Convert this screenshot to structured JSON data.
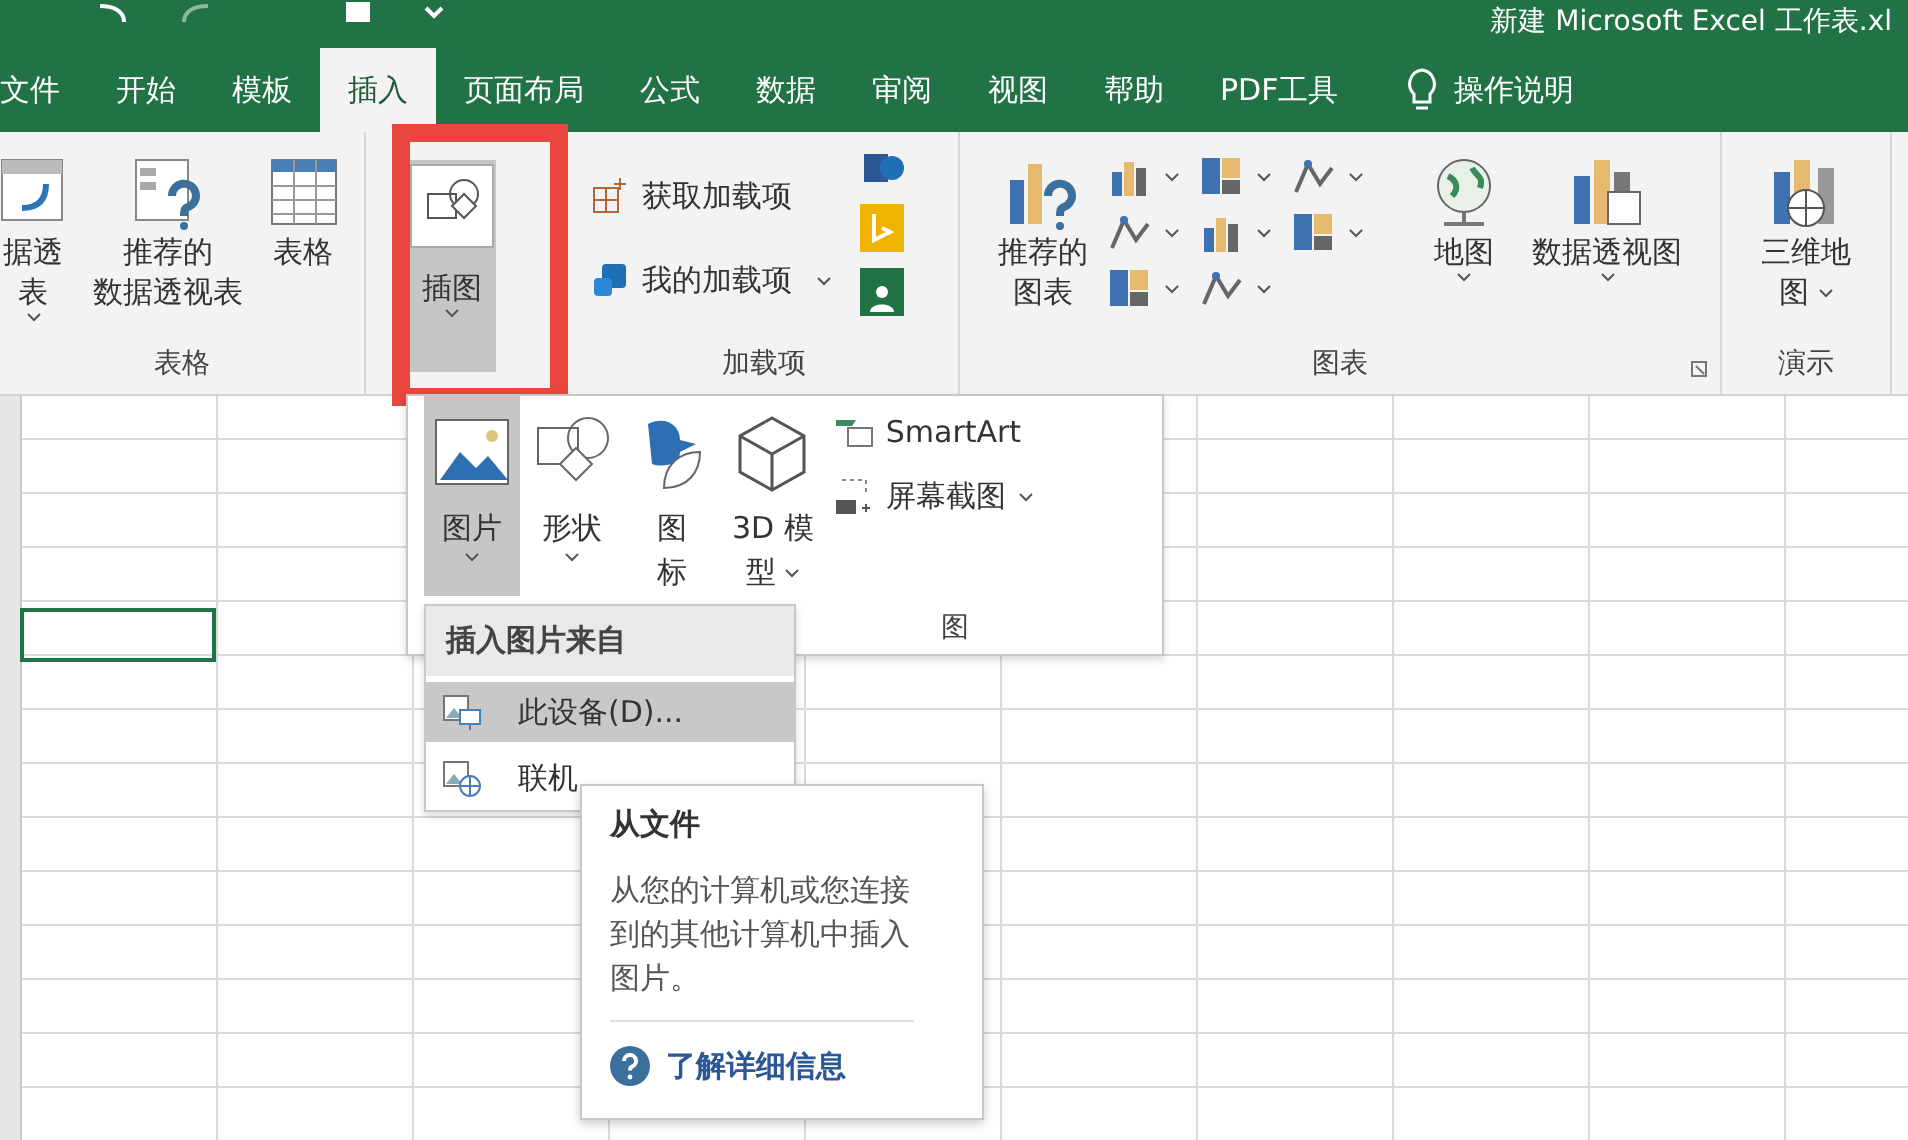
{
  "title_bar": {
    "title": "新建 Microsoft Excel 工作表.xl"
  },
  "tabs": [
    {
      "label": "文件",
      "selected": false
    },
    {
      "label": "开始",
      "selected": false
    },
    {
      "label": "模板",
      "selected": false
    },
    {
      "label": "插入",
      "selected": true
    },
    {
      "label": "页面布局",
      "selected": false
    },
    {
      "label": "公式",
      "selected": false
    },
    {
      "label": "数据",
      "selected": false
    },
    {
      "label": "审阅",
      "selected": false
    },
    {
      "label": "视图",
      "selected": false
    },
    {
      "label": "帮助",
      "selected": false
    },
    {
      "label": "PDF工具",
      "selected": false
    }
  ],
  "tell_me": {
    "label": "操作说明"
  },
  "ribbon": {
    "tables": {
      "label": "表格",
      "buttons": [
        {
          "kind": "pivot",
          "lines": [
            "据透",
            "表"
          ],
          "dropdown": true
        },
        {
          "kind": "recommended-pivot",
          "lines": [
            "推荐的",
            "数据透视表"
          ],
          "dropdown": false
        },
        {
          "kind": "table",
          "lines": [
            "表格"
          ],
          "dropdown": false
        }
      ]
    },
    "illustrations": {
      "lines": [
        "插图"
      ],
      "dropdown": true,
      "pressed": true,
      "highlighted": true
    },
    "addins": {
      "label": "加载项",
      "items": [
        {
          "kind": "store",
          "label": "获取加载项",
          "dropdown": false
        },
        {
          "kind": "my",
          "label": "我的加载项",
          "dropdown": true
        }
      ]
    },
    "charts": {
      "label": "图表",
      "recommended": {
        "lines": [
          "推荐的",
          "图表"
        ]
      },
      "map": {
        "lines": [
          "地图"
        ],
        "dropdown": true
      },
      "pivot_chart": {
        "lines": [
          "数据透视图"
        ],
        "dropdown": true
      }
    },
    "tours": {
      "label": "演示",
      "button": {
        "lines": [
          "三维地",
          "图"
        ],
        "dropdown": true
      }
    }
  },
  "gallery": {
    "group_label": "图",
    "items": [
      {
        "kind": "picture",
        "lines": [
          "图片"
        ],
        "dropdown": true,
        "pressed": true
      },
      {
        "kind": "shapes",
        "lines": [
          "形状"
        ],
        "dropdown": true,
        "pressed": false
      },
      {
        "kind": "icons",
        "lines": [
          "图",
          "标"
        ],
        "dropdown": false,
        "pressed": false
      },
      {
        "kind": "model",
        "lines": [
          "3D 模",
          "型"
        ],
        "dropdown": true,
        "pressed": false
      }
    ],
    "side": [
      {
        "kind": "smartart",
        "label": "SmartArt",
        "dropdown": false
      },
      {
        "kind": "screenshot",
        "label": "屏幕截图",
        "dropdown": true
      }
    ]
  },
  "picture_menu": {
    "header": "插入图片来自",
    "items": [
      {
        "kind": "device",
        "label": "此设备(D)...",
        "highlighted": true
      },
      {
        "kind": "online",
        "label": "联机",
        "highlighted": false
      }
    ]
  },
  "tooltip": {
    "title": "从文件",
    "body": "从您的计算机或您连接到的其他计算机中插入图片。",
    "link": "了解详细信息"
  }
}
